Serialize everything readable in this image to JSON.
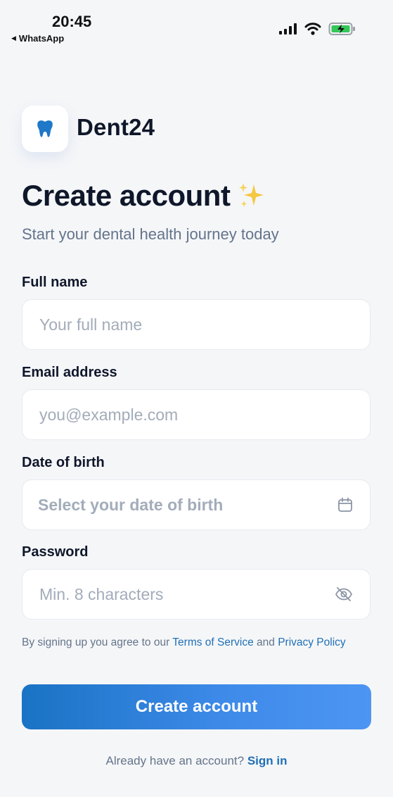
{
  "status_bar": {
    "time": "20:45",
    "back_app": "WhatsApp",
    "icons": [
      "cellular-signal-icon",
      "wifi-icon",
      "battery-charging-icon"
    ]
  },
  "brand": {
    "icon": "tooth-icon",
    "name": "Dent24",
    "accent_color": "#1f78c8"
  },
  "header": {
    "title": "Create account",
    "title_icon": "sparkles-icon",
    "subtitle": "Start your dental health journey today"
  },
  "form": {
    "full_name": {
      "label": "Full name",
      "placeholder": "Your full name",
      "value": ""
    },
    "email": {
      "label": "Email address",
      "placeholder": "you@example.com",
      "value": ""
    },
    "dob": {
      "label": "Date of birth",
      "placeholder": "Select your date of birth",
      "icon": "calendar-icon"
    },
    "password": {
      "label": "Password",
      "placeholder": "Min. 8 characters",
      "value": "",
      "icon": "eye-off-icon"
    }
  },
  "terms": {
    "prefix": "By signing up you agree to our ",
    "tos_link": "Terms of Service",
    "and": " and ",
    "privacy_link": "Privacy Policy"
  },
  "submit": {
    "label": "Create account"
  },
  "signin": {
    "prompt": "Already have an account? ",
    "link": "Sign in"
  },
  "colors": {
    "background": "#f5f6f8",
    "primary_gradient_start": "#1a73c4",
    "primary_gradient_end": "#4d95f2",
    "link": "#1f6fb5",
    "text_muted": "#64748b",
    "placeholder": "#a3acba"
  }
}
